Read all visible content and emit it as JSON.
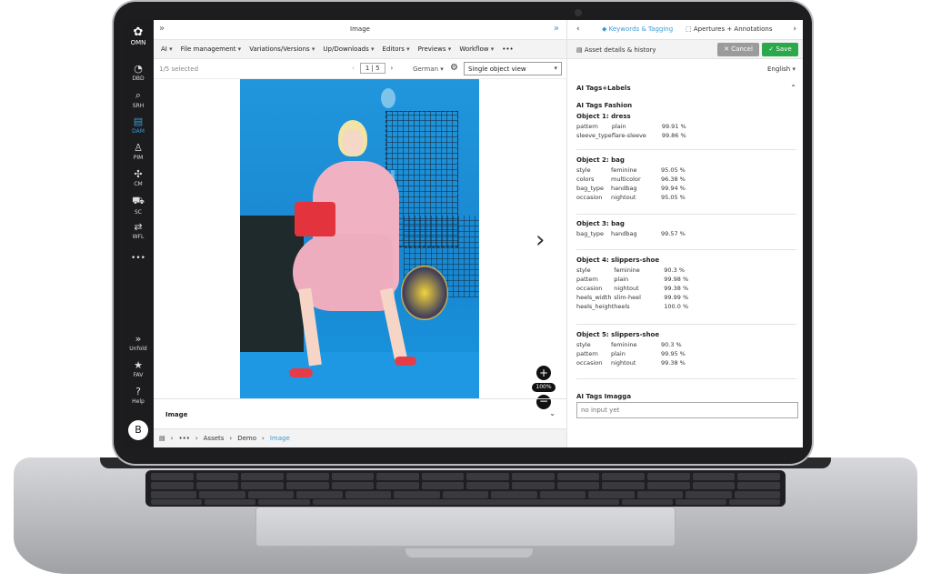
{
  "sidebar": {
    "logo": "OMN",
    "items": [
      {
        "label": "DBD",
        "icon": "dashboard-icon"
      },
      {
        "label": "SRH",
        "icon": "search-icon"
      },
      {
        "label": "DAM",
        "icon": "images-icon"
      },
      {
        "label": "PIM",
        "icon": "product-icon"
      },
      {
        "label": "CM",
        "icon": "network-icon"
      },
      {
        "label": "SC",
        "icon": "cart-icon"
      },
      {
        "label": "WFL",
        "icon": "workflow-icon"
      },
      {
        "label": "•••",
        "icon": "more-icon"
      }
    ],
    "bottom": [
      {
        "label": "Unfold",
        "icon": "unfold-icon"
      },
      {
        "label": "FAV",
        "icon": "star-icon"
      },
      {
        "label": "Help",
        "icon": "help-icon"
      }
    ],
    "avatar": "B"
  },
  "center": {
    "title": "Image",
    "menu": [
      "AI",
      "File management",
      "Variations/Versions",
      "Up/Downloads",
      "Editors",
      "Previews",
      "Workflow",
      "•••"
    ],
    "selection": "1/5 selected",
    "pager": "1 | 5",
    "language": "German",
    "view_mode": "Single object view",
    "zoom": "100%",
    "section_label": "Image",
    "breadcrumb": [
      "•••",
      "Assets",
      "Demo",
      "Image"
    ]
  },
  "right": {
    "tab_keywords": "Keywords & Tagging",
    "tab_apertures": "Apertures + Annotations",
    "details": "Asset details & history",
    "cancel": "Cancel",
    "save": "Save",
    "language": "English",
    "ai_tags_header": "AI Tags+Labels",
    "ai_fashion_header": "AI Tags Fashion",
    "objects": [
      {
        "title": "Object 1: dress",
        "rows": [
          [
            "pattern",
            "plain",
            "99.91 %"
          ],
          [
            "sleeve_type",
            "flare-sleeve",
            "99.86 %"
          ]
        ]
      },
      {
        "title": "Object 2: bag",
        "rows": [
          [
            "style",
            "feminine",
            "95.05 %"
          ],
          [
            "colors",
            "multicolor",
            "96.38 %"
          ],
          [
            "bag_type",
            "handbag",
            "99.94 %"
          ],
          [
            "occasion",
            "nightout",
            "95.05 %"
          ]
        ]
      },
      {
        "title": "Object 3: bag",
        "rows": [
          [
            "bag_type",
            "handbag",
            "99.57 %"
          ]
        ]
      },
      {
        "title": "Object 4: slippers-shoe",
        "rows": [
          [
            "style",
            "feminine",
            "90.3 %"
          ],
          [
            "pattern",
            "plain",
            "99.98 %"
          ],
          [
            "occasion",
            "nightout",
            "99.38 %"
          ],
          [
            "heels_width",
            "slim-heel",
            "99.99 %"
          ],
          [
            "heels_height",
            "heels",
            "100.0 %"
          ]
        ]
      },
      {
        "title": "Object 5: slippers-shoe",
        "rows": [
          [
            "style",
            "feminine",
            "90.3 %"
          ],
          [
            "pattern",
            "plain",
            "99.95 %"
          ],
          [
            "occasion",
            "nightout",
            "99.38 %"
          ]
        ]
      }
    ],
    "imagga_header": "AI Tags Imagga",
    "imagga_placeholder": "no input yet"
  },
  "colors": {
    "accent": "#3a9ad9",
    "save": "#2aa84a",
    "cancel": "#9b9b9b",
    "sidebar": "#1c1c1e"
  }
}
